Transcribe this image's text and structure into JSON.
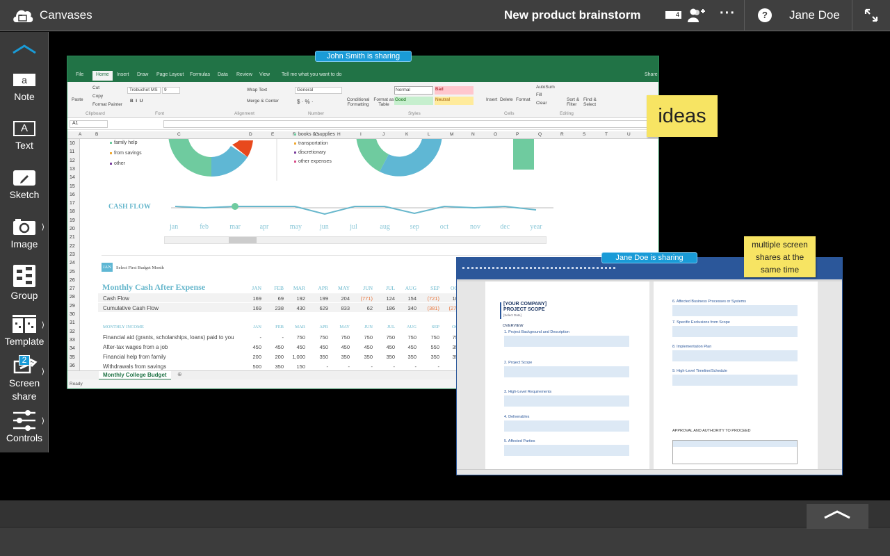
{
  "topbar": {
    "app_name": "Canvases",
    "canvas_title": "New product brainstorm",
    "participant_count": "4",
    "user_name": "Jane Doe",
    "help": "?"
  },
  "sidebar": {
    "items": [
      {
        "label": "Note",
        "icon_text": "a"
      },
      {
        "label": "Text",
        "icon_text": "A"
      },
      {
        "label": "Sketch"
      },
      {
        "label": "Image"
      },
      {
        "label": "Group"
      },
      {
        "label": "Template"
      },
      {
        "label": "Screen share",
        "badge": "2"
      },
      {
        "label": "Controls"
      }
    ]
  },
  "shares": [
    {
      "badge": "John Smith is sharing"
    },
    {
      "badge": "Jane Doe is sharing"
    }
  ],
  "notes": [
    {
      "text": "ideas"
    },
    {
      "text": "multiple screen shares at the same time"
    }
  ],
  "excel": {
    "tabs": [
      "File",
      "Home",
      "Insert",
      "Draw",
      "Page Layout",
      "Formulas",
      "Data",
      "Review",
      "View",
      "Tell me what you want to do"
    ],
    "share": "Share",
    "ribbon": {
      "paste": "Paste",
      "cut": "Cut",
      "copy": "Copy",
      "format_painter": "Format Painter",
      "font": "Trebuchet MS",
      "size": "9",
      "wrap": "Wrap Text",
      "merge": "Merge & Center",
      "number_format": "General",
      "cond": "Conditional Formatting",
      "format_table": "Format as Table",
      "normal": "Normal",
      "bad": "Bad",
      "good": "Good",
      "neutral": "Neutral",
      "insert": "Insert",
      "delete": "Delete",
      "format": "Format",
      "autosum": "AutoSum",
      "fill": "Fill",
      "clear": "Clear",
      "sort": "Sort & Filter",
      "find": "Find & Select",
      "groups": [
        "Clipboard",
        "Font",
        "Alignment",
        "Number",
        "Styles",
        "Cells",
        "Editing"
      ]
    },
    "name_box": "A1",
    "columns": [
      "A",
      "B",
      "C",
      "D",
      "E",
      "F",
      "G",
      "H",
      "I",
      "J",
      "K",
      "L",
      "M",
      "N",
      "O",
      "P",
      "Q",
      "R",
      "S",
      "T",
      "U"
    ],
    "rows": [
      "10",
      "11",
      "12",
      "13",
      "14",
      "15",
      "16",
      "17",
      "18",
      "19",
      "20",
      "21",
      "22",
      "23",
      "24",
      "25",
      "26",
      "27",
      "28",
      "29",
      "30",
      "31",
      "32",
      "33",
      "34",
      "35",
      "36"
    ],
    "legend_income": [
      "family help",
      "from savings",
      "other"
    ],
    "legend_expense": [
      "books & supplies",
      "transportation",
      "discretionary",
      "other expenses"
    ],
    "cash_flow_title": "CASH FLOW",
    "chart_months": [
      "jan",
      "feb",
      "mar",
      "apr",
      "may",
      "jun",
      "jul",
      "aug",
      "sep",
      "oct",
      "nov",
      "dec",
      "year"
    ],
    "month_select": {
      "badge": "JAN",
      "label": "Select First Budget Month"
    },
    "months": [
      "JAN",
      "FEB",
      "MAR",
      "APR",
      "MAY",
      "JUN",
      "JUL",
      "AUG",
      "SEP",
      "OCT"
    ],
    "cash_title": "Monthly Cash After Expense",
    "cash_rows": [
      {
        "label": "Cash Flow",
        "values": [
          "169",
          "69",
          "192",
          "199",
          "204",
          "(771)",
          "124",
          "154",
          "(721)",
          "109"
        ]
      },
      {
        "label": "Cumulative Cash Flow",
        "values": [
          "169",
          "238",
          "430",
          "629",
          "833",
          "62",
          "186",
          "340",
          "(381)",
          "(272)"
        ]
      }
    ],
    "income_title": "MONTHLY INCOME",
    "income_rows": [
      {
        "label": "Financial aid (grants, scholarships, loans) paid to you",
        "values": [
          "-",
          "-",
          "750",
          "750",
          "750",
          "750",
          "750",
          "750",
          "750",
          "750"
        ]
      },
      {
        "label": "After-tax wages from a job",
        "values": [
          "450",
          "450",
          "450",
          "450",
          "450",
          "450",
          "450",
          "450",
          "550",
          "350"
        ]
      },
      {
        "label": "Financial help from family",
        "values": [
          "200",
          "200",
          "1,000",
          "350",
          "350",
          "350",
          "350",
          "350",
          "350",
          "350"
        ]
      },
      {
        "label": "Withdrawals from savings",
        "values": [
          "500",
          "350",
          "150",
          "-",
          "-",
          "-",
          "-",
          "-",
          "-",
          "-"
        ]
      }
    ],
    "sheet_tab": "Monthly College Budget",
    "status": "Ready",
    "negative_color": "#e8743b"
  },
  "word": {
    "company": "[YOUR COMPANY]",
    "doc_title": "PROJECT SCOPE",
    "date": "[Select Date]",
    "overview": "OVERVIEW",
    "left_sections": [
      "1. Project Background and Description",
      "2. Project Scope",
      "3. High-Level Requirements",
      "4. Deliverables",
      "5. Affected Parties"
    ],
    "right_sections": [
      "6. Affected Business Processes or Systems",
      "7. Specific Exclusions from Scope",
      "8. Implementation Plan",
      "9. High-Level Timeline/Schedule"
    ],
    "approval": "APPROVAL AND AUTHORITY TO PROCEED"
  },
  "colors": {
    "accent": "#1a9bd7",
    "note": "#f7e463",
    "excel": "#217346",
    "word": "#2b579a",
    "topbar": "#3f3f3f"
  }
}
